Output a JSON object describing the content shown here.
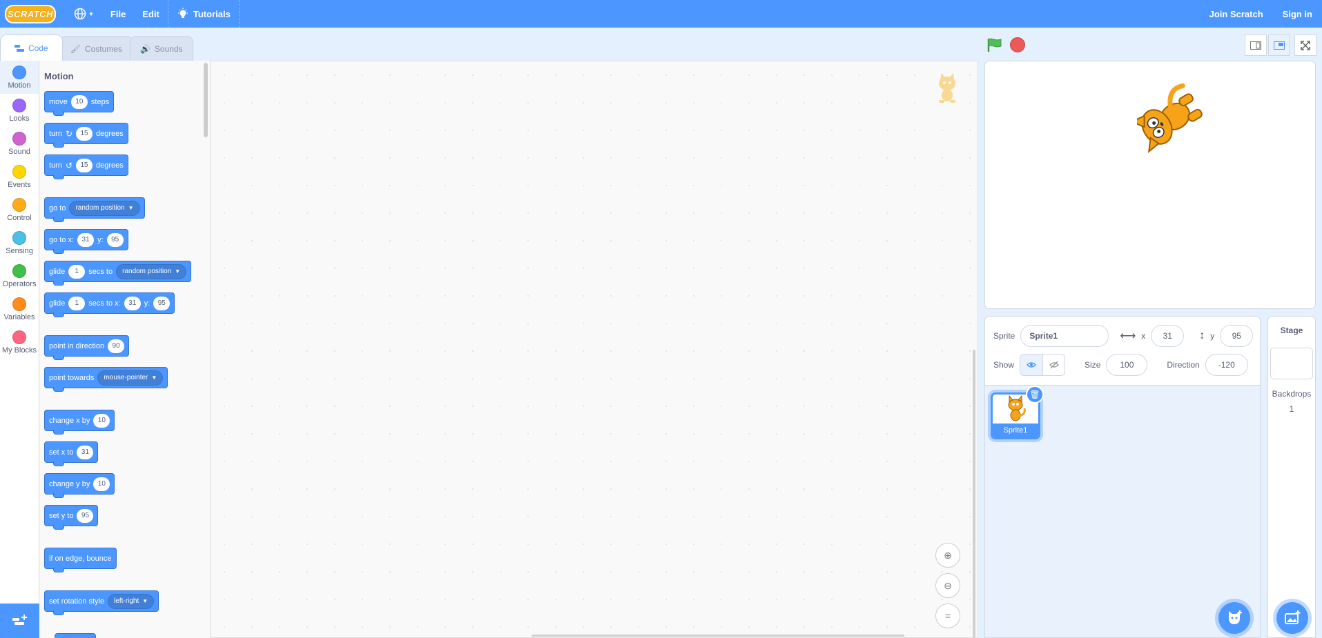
{
  "menubar": {
    "logo_text": "SCRATCH",
    "file": "File",
    "edit": "Edit",
    "tutorials": "Tutorials",
    "join": "Join Scratch",
    "signin": "Sign in",
    "bg_color": "#4c97ff"
  },
  "tabs": {
    "code": "Code",
    "costumes": "Costumes",
    "sounds": "Sounds"
  },
  "categories": [
    {
      "label": "Motion",
      "color": "#4c97ff"
    },
    {
      "label": "Looks",
      "color": "#9966ff"
    },
    {
      "label": "Sound",
      "color": "#cf63cf"
    },
    {
      "label": "Events",
      "color": "#ffd500"
    },
    {
      "label": "Control",
      "color": "#ffab19"
    },
    {
      "label": "Sensing",
      "color": "#4cbfe6"
    },
    {
      "label": "Operators",
      "color": "#40bf4a"
    },
    {
      "label": "Variables",
      "color": "#ff8c1a"
    },
    {
      "label": "My Blocks",
      "color": "#ff6680"
    }
  ],
  "palette": {
    "title": "Motion",
    "move": {
      "a": "move",
      "v": "10",
      "b": "steps"
    },
    "turn_right": {
      "a": "turn",
      "v": "15",
      "b": "degrees"
    },
    "turn_left": {
      "a": "turn",
      "v": "15",
      "b": "degrees"
    },
    "goto": {
      "a": "go to",
      "dd": "random position"
    },
    "goto_xy": {
      "a": "go to x:",
      "x": "31",
      "b": "y:",
      "y": "95"
    },
    "glide_to": {
      "a": "glide",
      "v": "1",
      "b": "secs to",
      "dd": "random position"
    },
    "glide_xy": {
      "a": "glide",
      "v": "1",
      "b": "secs to x:",
      "x": "31",
      "c": "y:",
      "y": "95"
    },
    "point_dir": {
      "a": "point in direction",
      "v": "90"
    },
    "point_towards": {
      "a": "point towards",
      "dd": "mouse-pointer"
    },
    "change_x": {
      "a": "change x by",
      "v": "10"
    },
    "set_x": {
      "a": "set x to",
      "v": "31"
    },
    "change_y": {
      "a": "change y by",
      "v": "10"
    },
    "set_y": {
      "a": "set y to",
      "v": "95"
    },
    "bounce": {
      "a": "if on edge, bounce"
    },
    "rot_style": {
      "a": "set rotation style",
      "dd": "left-right"
    }
  },
  "sprite_info": {
    "sprite_label": "Sprite",
    "sprite_name": "Sprite1",
    "x_label": "x",
    "x_value": "31",
    "y_label": "y",
    "y_value": "95",
    "show_label": "Show",
    "size_label": "Size",
    "size_value": "100",
    "direction_label": "Direction",
    "direction_value": "-120"
  },
  "sprites": [
    {
      "name": "Sprite1"
    }
  ],
  "stage_pane": {
    "title": "Stage",
    "backdrops_label": "Backdrops",
    "backdrops_count": "1"
  }
}
